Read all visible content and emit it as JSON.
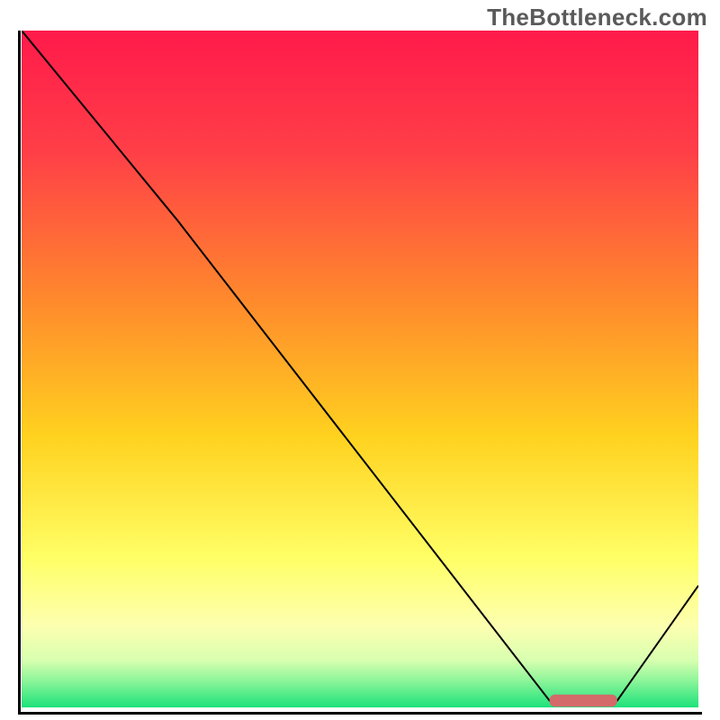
{
  "watermark": "TheBottleneck.com",
  "chart_data": {
    "type": "line",
    "title": "",
    "xlabel": "",
    "ylabel": "",
    "xlim": [
      0,
      100
    ],
    "ylim": [
      0,
      100
    ],
    "series": [
      {
        "name": "bottleneck-curve",
        "x": [
          0,
          23,
          78,
          88,
          100
        ],
        "y": [
          100,
          72,
          1,
          1,
          18
        ]
      }
    ],
    "marker": {
      "name": "optimal-range",
      "x_start": 78,
      "x_end": 88,
      "y": 1,
      "color": "#d46a6a"
    },
    "gradient_stops": [
      {
        "offset": 0,
        "color": "#ff1a4b"
      },
      {
        "offset": 18,
        "color": "#ff3f47"
      },
      {
        "offset": 40,
        "color": "#ff8a2c"
      },
      {
        "offset": 60,
        "color": "#ffd21f"
      },
      {
        "offset": 78,
        "color": "#ffff66"
      },
      {
        "offset": 88,
        "color": "#fdffb0"
      },
      {
        "offset": 93,
        "color": "#d8ffb0"
      },
      {
        "offset": 96,
        "color": "#8ef59a"
      },
      {
        "offset": 100,
        "color": "#1de27a"
      }
    ]
  }
}
